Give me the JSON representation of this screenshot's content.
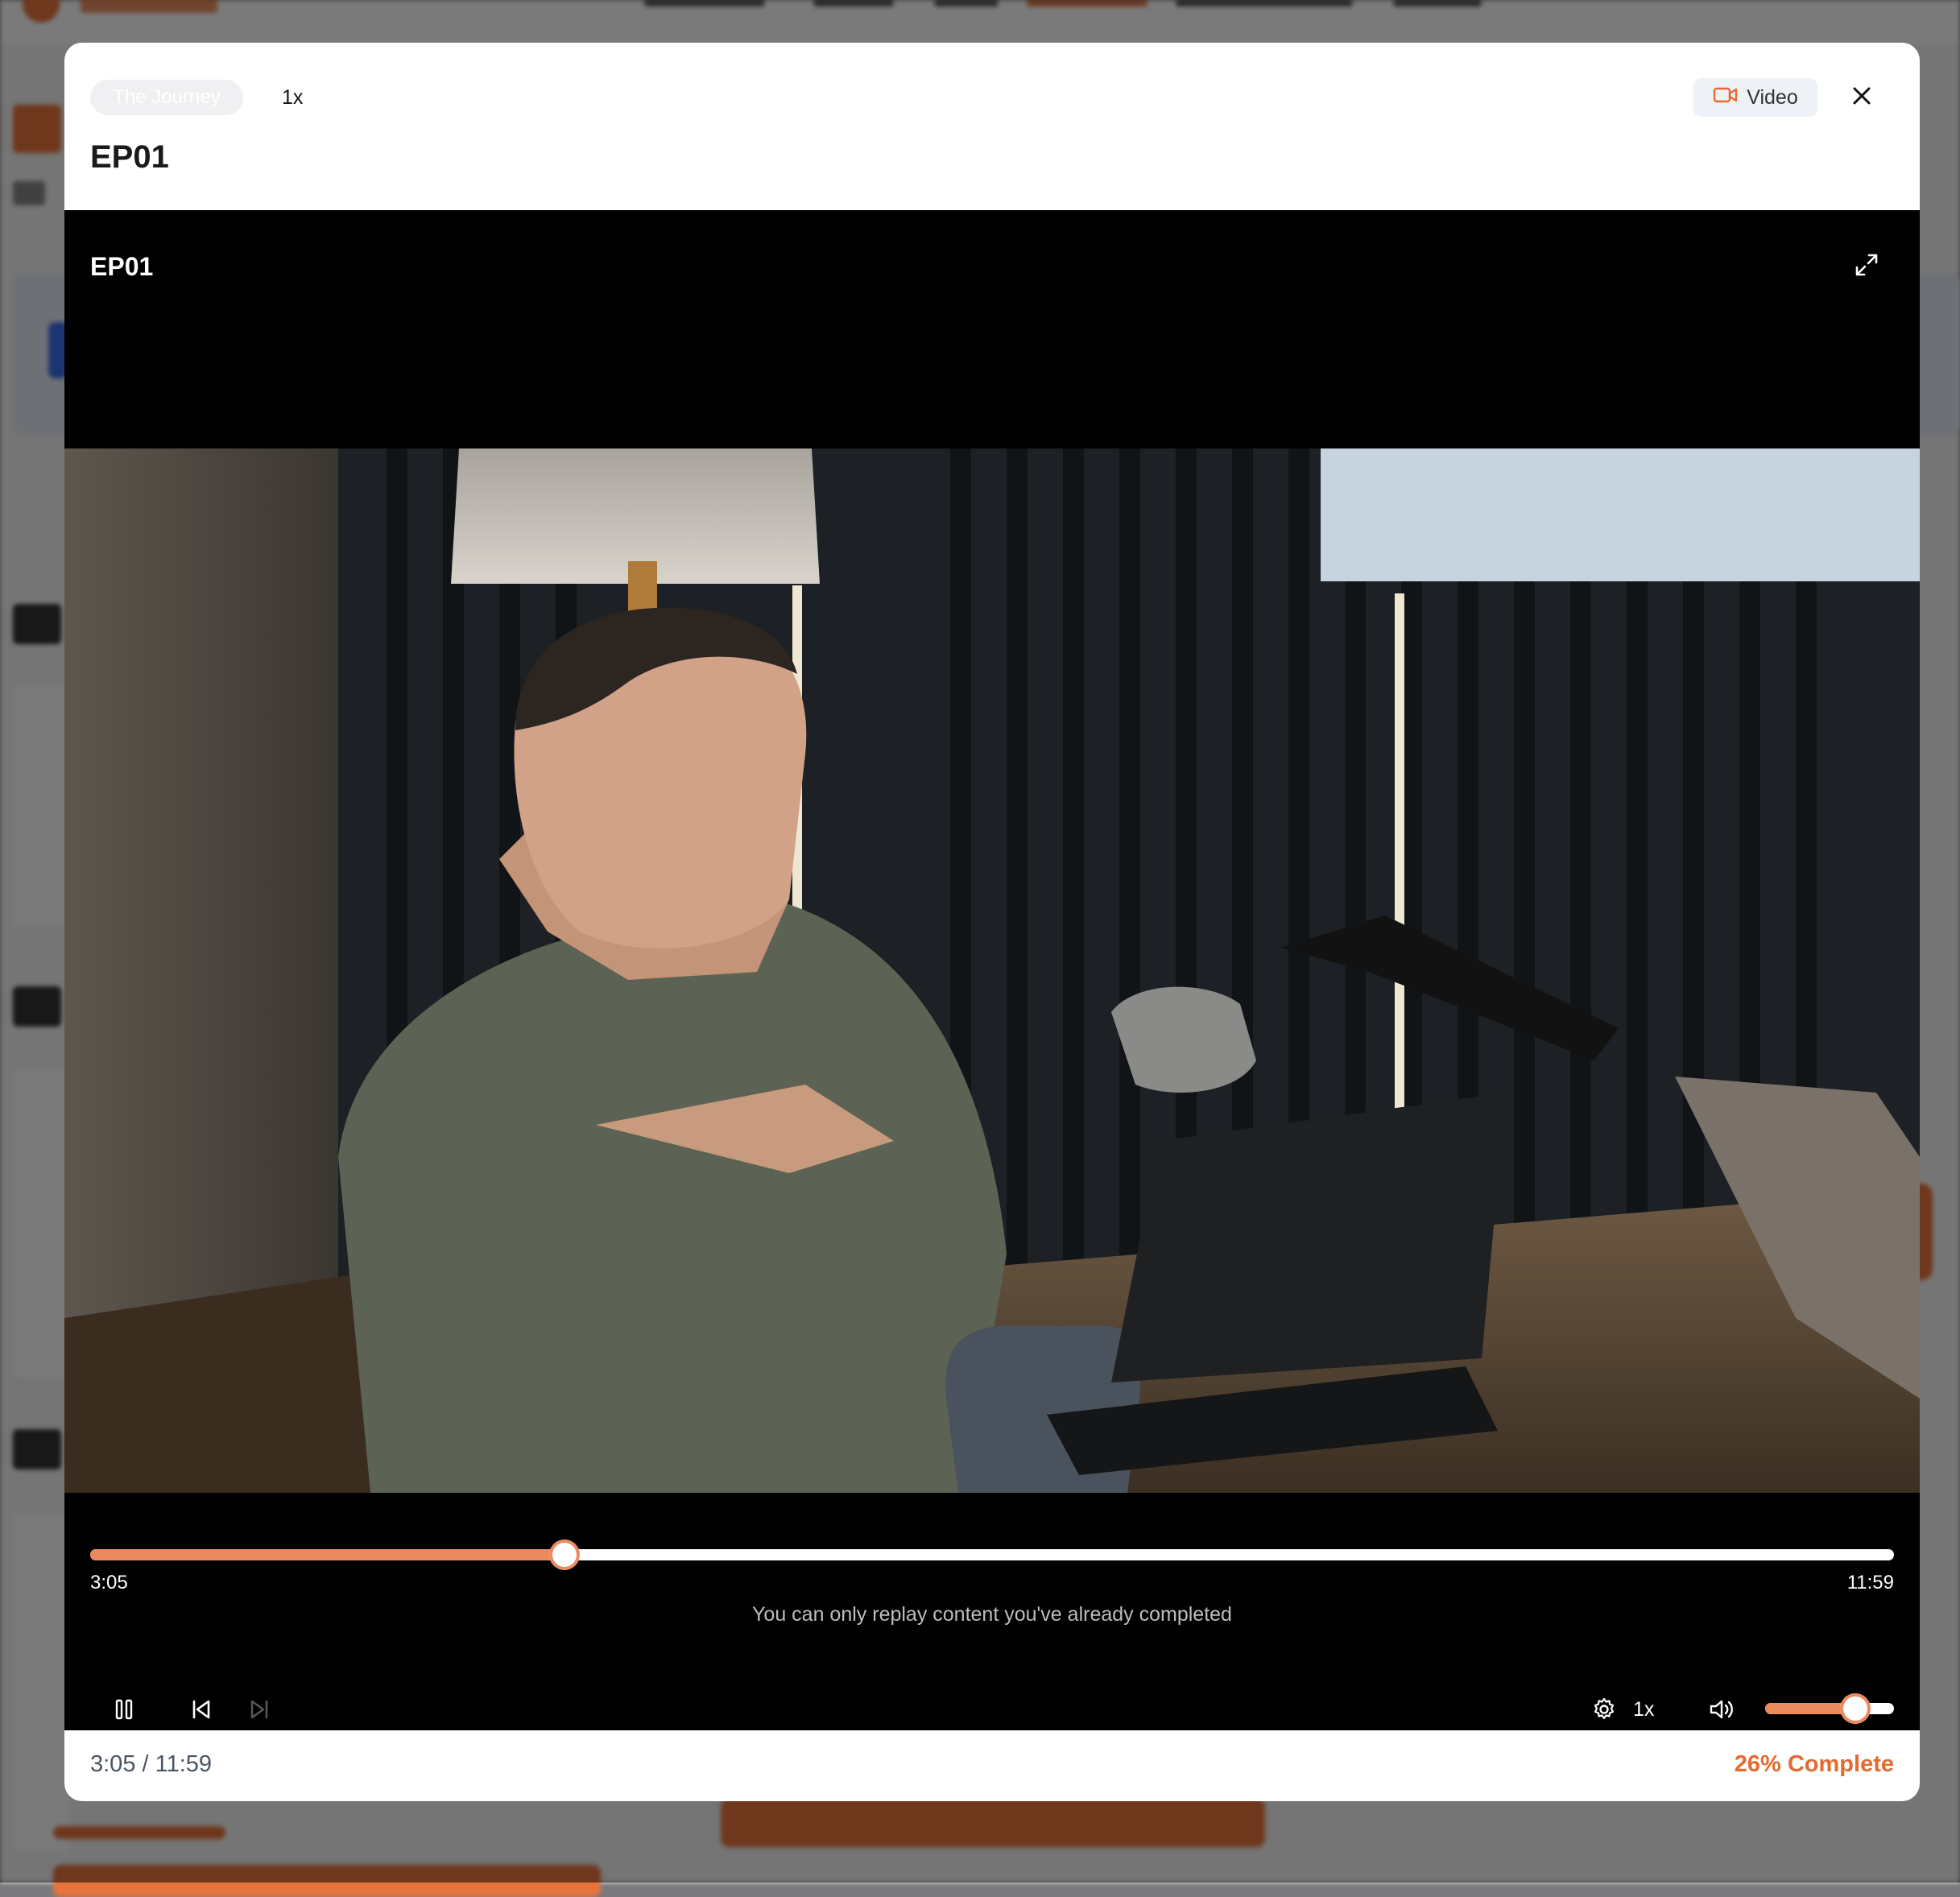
{
  "modal": {
    "series_label": "The Journey",
    "speed_label": "1x",
    "content_type": "Video",
    "title": "EP01"
  },
  "player": {
    "title": "EP01",
    "current_time": "3:05",
    "total_time": "11:59",
    "progress_fraction": 0.263,
    "replay_note": "You can only replay content you've already completed",
    "speed": "1x",
    "volume_fraction": 0.7
  },
  "footer": {
    "time_summary": "3:05 / 11:59",
    "complete_label": "26% Complete"
  },
  "colors": {
    "accent": "#ea8a5e",
    "accent_text": "#e56a2f"
  },
  "icons": {
    "type": "video-camera-icon",
    "close": "close-icon",
    "fullscreen": "expand-icon",
    "pause": "pause-icon",
    "previous": "skip-back-icon",
    "next": "skip-forward-icon",
    "settings": "gear-icon",
    "volume": "volume-icon"
  }
}
